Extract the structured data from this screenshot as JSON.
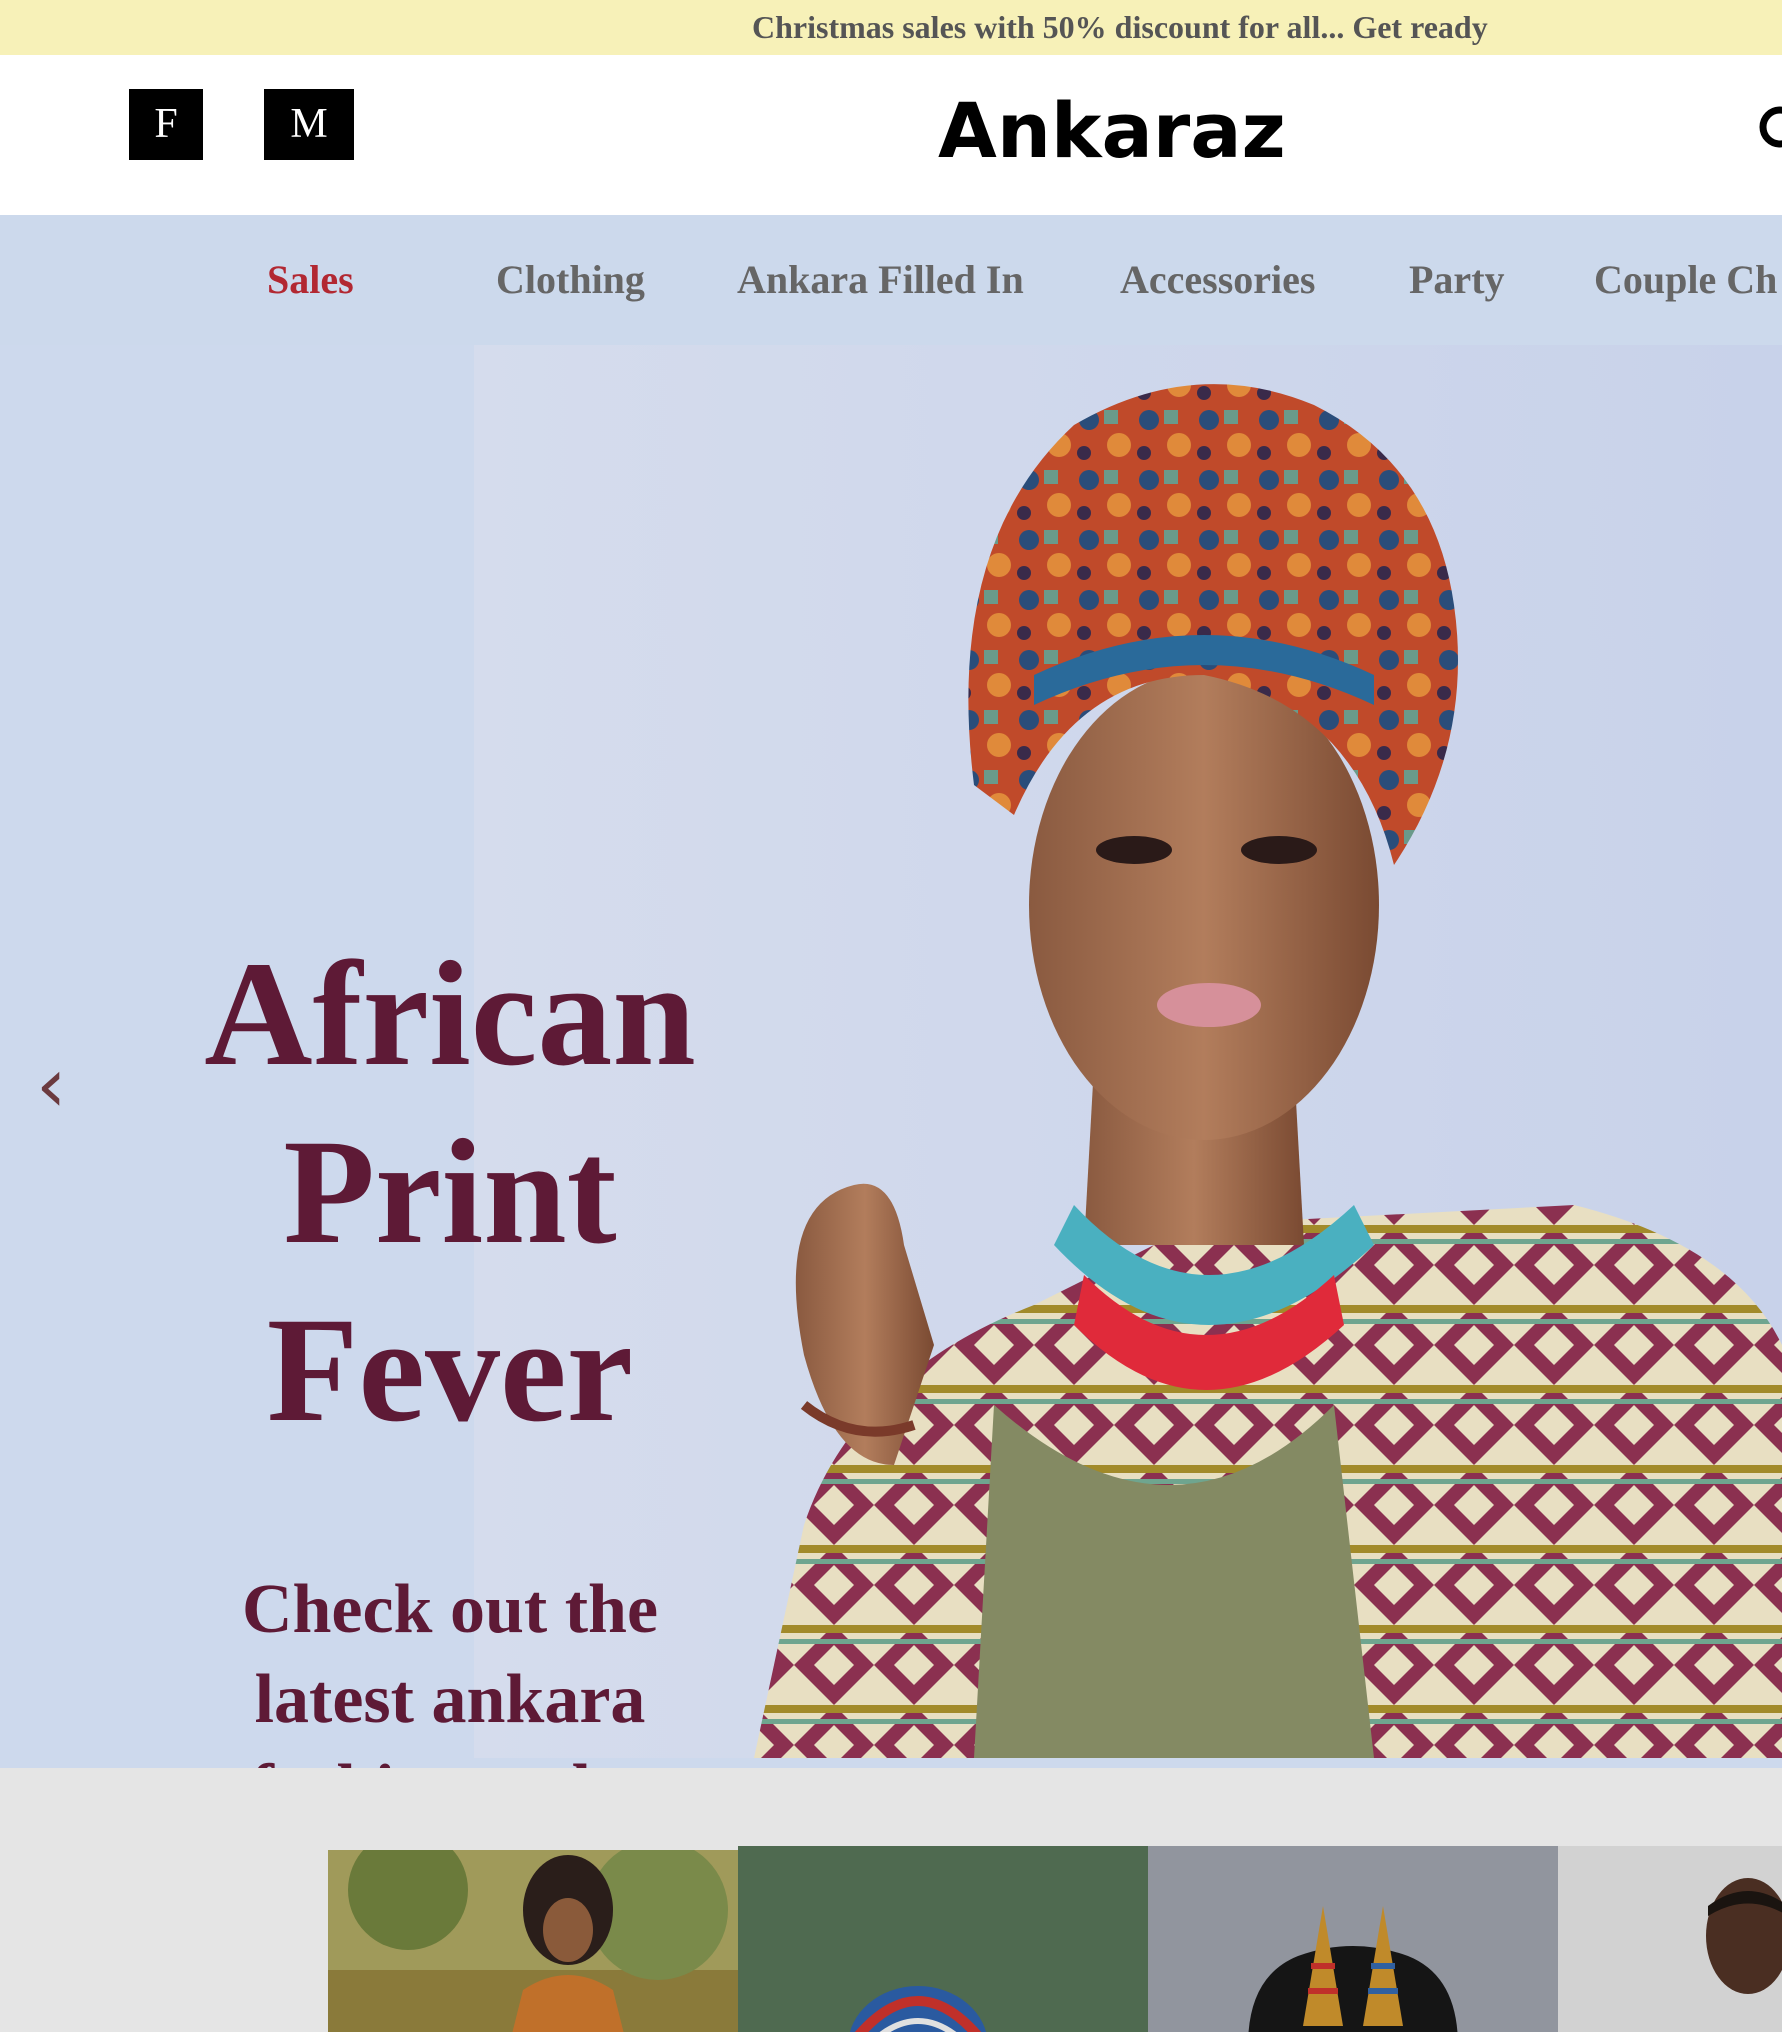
{
  "promo": {
    "text": "Christmas sales with 50% discount for all... Get ready"
  },
  "header": {
    "social_f": "F",
    "social_m": "M",
    "brand": "Ankaraz",
    "search_icon": "search-icon"
  },
  "nav": {
    "items": [
      {
        "label": "Sales",
        "active": true
      },
      {
        "label": "Clothing",
        "active": false
      },
      {
        "label": "Ankara Filled In",
        "active": false
      },
      {
        "label": "Accessories",
        "active": false
      },
      {
        "label": "Party",
        "active": false
      },
      {
        "label": "Couple Ch",
        "active": false
      }
    ]
  },
  "hero": {
    "prev_icon": "chevron-left-icon",
    "prev_glyph": "‹",
    "title_line1": "African",
    "title_line2": "Print",
    "title_line3": "Fever",
    "sub_line1": "Check out the",
    "sub_line2": "latest ankara",
    "sub_line3": "fashion styles"
  },
  "colors": {
    "promo_bg": "#f7f1b8",
    "nav_bg": "#ccd9ec",
    "nav_active": "#b22832",
    "hero_text": "#5e1a36",
    "cards_bg": "#e5e5e5"
  },
  "categories": [
    {
      "image": "woman-in-ankara-dress"
    },
    {
      "image": "ankara-head-wrap"
    },
    {
      "image": "ankara-earrings"
    },
    {
      "image": "man-in-ankara"
    }
  ]
}
